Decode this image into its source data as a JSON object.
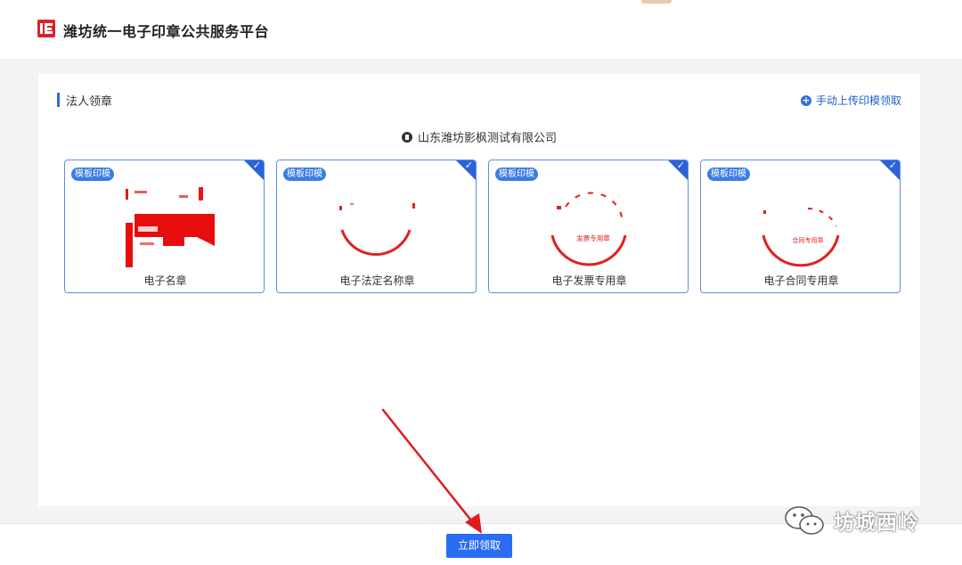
{
  "header": {
    "title": "潍坊统一电子印章公共服务平台",
    "logo_icon": "seal-platform-logo-icon",
    "brand_color": "#d9232b"
  },
  "section": {
    "title": "法人领章",
    "upload_label": "手动上传印模领取",
    "upload_icon": "plus-circle-icon",
    "accent_color": "#2b6be0"
  },
  "company": {
    "name": "山东潍坊影枫测试有限公司",
    "icon": "building-icon"
  },
  "seals": [
    {
      "badge": "模板印模",
      "label": "电子名章",
      "selected": true,
      "seal_text": ""
    },
    {
      "badge": "模板印模",
      "label": "电子法定名称章",
      "selected": true,
      "seal_text": ""
    },
    {
      "badge": "模板印模",
      "label": "电子发票专用章",
      "selected": true,
      "seal_text": "发票专用章"
    },
    {
      "badge": "模板印模",
      "label": "电子合同专用章",
      "selected": true,
      "seal_text": "合同专用章"
    }
  ],
  "footer": {
    "submit_label": "立即领取",
    "submit_color": "#2a6cf2"
  },
  "watermark": {
    "text": "坊城西岭",
    "icon": "wechat-icon"
  }
}
